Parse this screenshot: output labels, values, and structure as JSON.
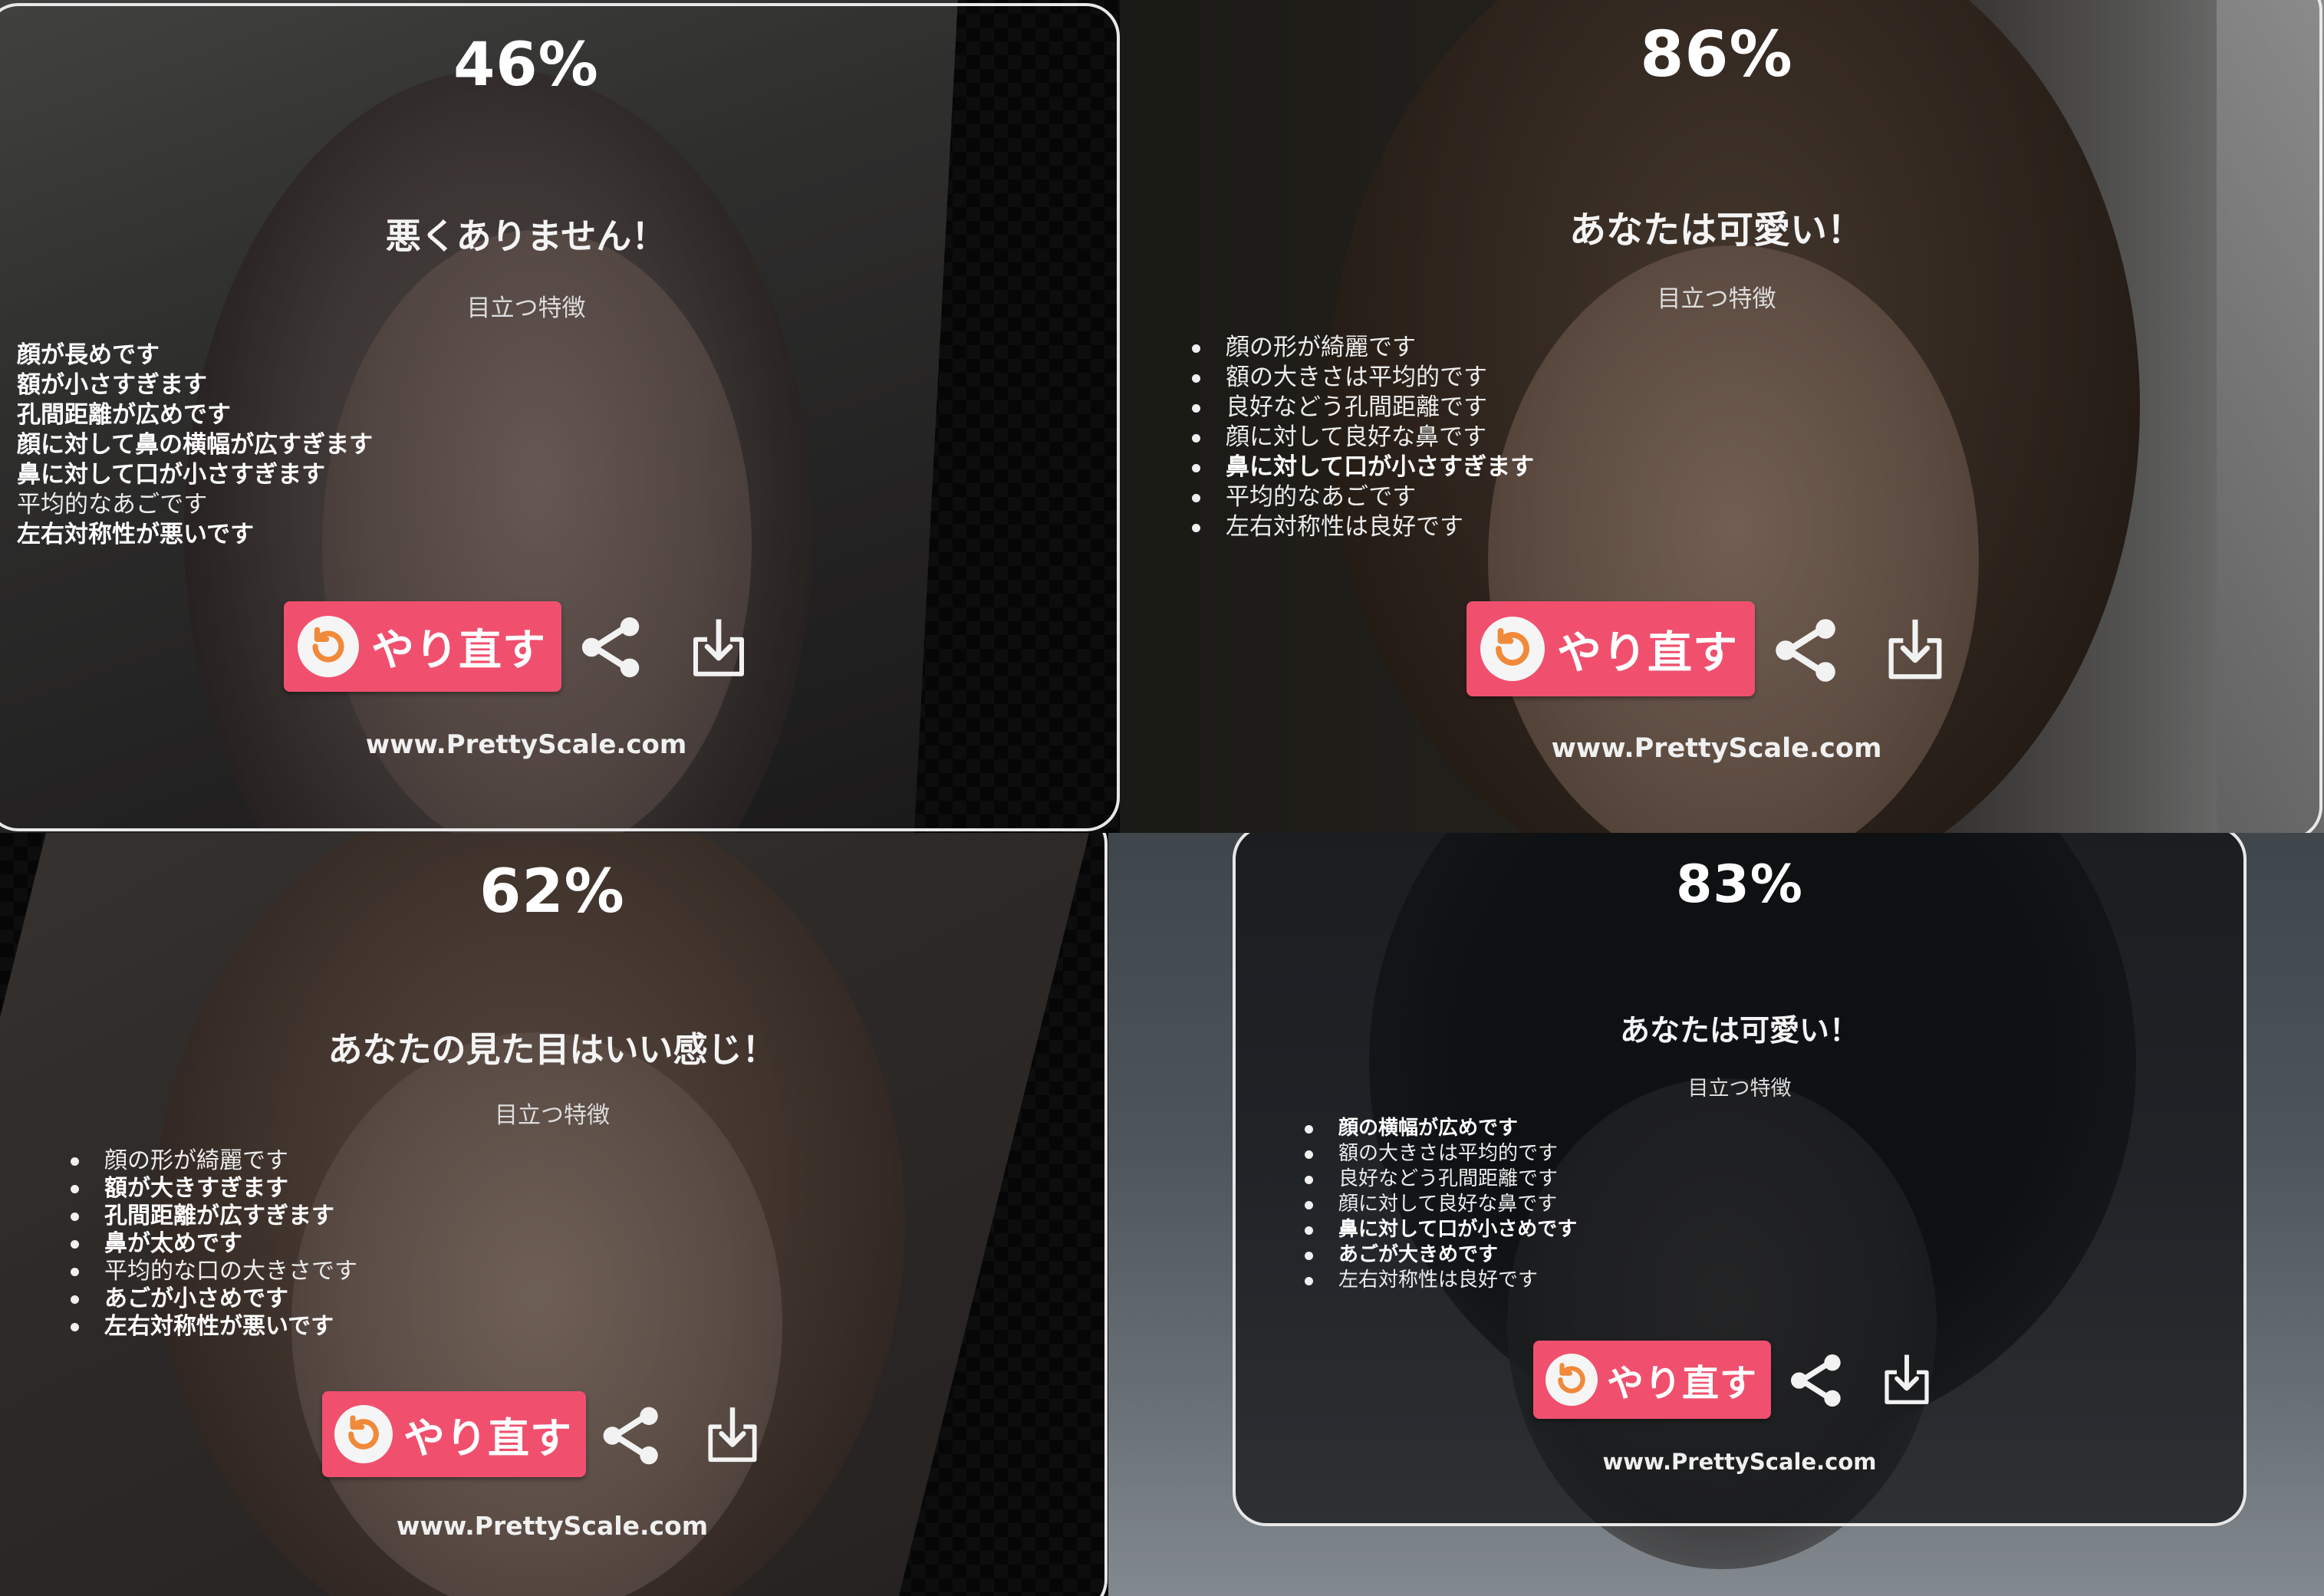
{
  "cards": [
    {
      "score": "46%",
      "headline": "悪くありません！",
      "subhead": "目立つ特徴",
      "features": [
        {
          "text": "顔が長めです",
          "bold": true
        },
        {
          "text": "額が小さすぎます",
          "bold": true
        },
        {
          "text": "孔間距離が広めです",
          "bold": true
        },
        {
          "text": "顔に対して鼻の横幅が広すぎます",
          "bold": true
        },
        {
          "text": "鼻に対して口が小さすぎます",
          "bold": true
        },
        {
          "text": "平均的なあごです",
          "bold": false
        },
        {
          "text": "左右対称性が悪いです",
          "bold": true
        }
      ],
      "retry_label": "やり直す",
      "website": "www.PrettyScale.com"
    },
    {
      "score": "86%",
      "headline": "あなたは可愛い！",
      "subhead": "目立つ特徴",
      "features": [
        {
          "text": "顔の形が綺麗です",
          "bold": false
        },
        {
          "text": "額の大きさは平均的です",
          "bold": false
        },
        {
          "text": "良好などう孔間距離です",
          "bold": false
        },
        {
          "text": "顔に対して良好な鼻です",
          "bold": false
        },
        {
          "text": "鼻に対して口が小さすぎます",
          "bold": true
        },
        {
          "text": "平均的なあごです",
          "bold": false
        },
        {
          "text": "左右対称性は良好です",
          "bold": false
        }
      ],
      "retry_label": "やり直す",
      "website": "www.PrettyScale.com"
    },
    {
      "score": "62%",
      "headline": "あなたの見た目はいい感じ！",
      "subhead": "目立つ特徴",
      "features": [
        {
          "text": "顔の形が綺麗です",
          "bold": false
        },
        {
          "text": "額が大きすぎます",
          "bold": true
        },
        {
          "text": "孔間距離が広すぎます",
          "bold": true
        },
        {
          "text": "鼻が太めです",
          "bold": true
        },
        {
          "text": "平均的な口の大きさです",
          "bold": false
        },
        {
          "text": "あごが小さめです",
          "bold": true
        },
        {
          "text": "左右対称性が悪いです",
          "bold": true
        }
      ],
      "retry_label": "やり直す",
      "website": "www.PrettyScale.com"
    },
    {
      "score": "83%",
      "headline": "あなたは可愛い！",
      "subhead": "目立つ特徴",
      "features": [
        {
          "text": "顔の横幅が広めです",
          "bold": true
        },
        {
          "text": "額の大きさは平均的です",
          "bold": false
        },
        {
          "text": "良好などう孔間距離です",
          "bold": false
        },
        {
          "text": "顔に対して良好な鼻です",
          "bold": false
        },
        {
          "text": "鼻に対して口が小さめです",
          "bold": true
        },
        {
          "text": "あごが大きめです",
          "bold": true
        },
        {
          "text": "左右対称性は良好です",
          "bold": false
        }
      ],
      "retry_label": "やり直す",
      "website": "www.PrettyScale.com"
    }
  ],
  "icons": {
    "retry": "refresh-icon",
    "share": "share-icon",
    "download": "download-icon"
  },
  "colors": {
    "retry_button": "#f0506e",
    "retry_icon_arrow": "#f08a3a",
    "panel_border": "#e8e8e8"
  }
}
